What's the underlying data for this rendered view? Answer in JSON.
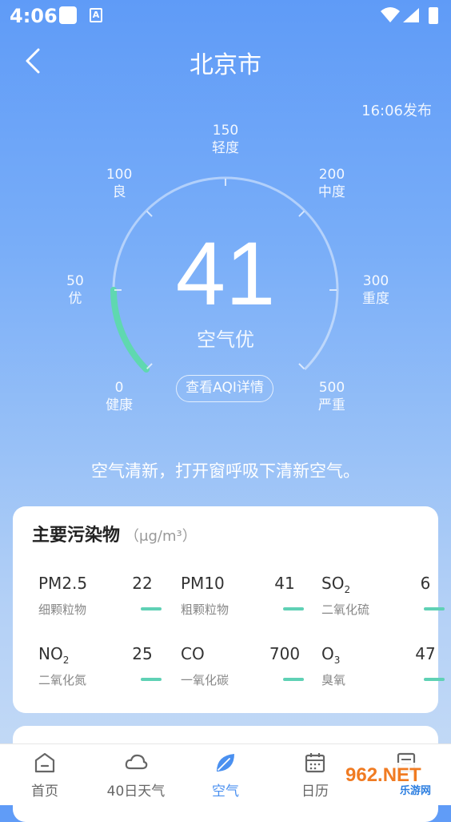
{
  "status": {
    "time": "4:06",
    "notif_icon_letter": "A"
  },
  "header": {
    "title": "北京市"
  },
  "publish_time": "16:06发布",
  "gauge": {
    "aqi": "41",
    "aqi_fraction": 0.082,
    "level": "空气优",
    "detail_button": "查看AQI详情",
    "accent_color": "#5fd8b0",
    "scale": [
      {
        "value": "0",
        "label": "健康"
      },
      {
        "value": "50",
        "label": "优"
      },
      {
        "value": "100",
        "label": "良"
      },
      {
        "value": "150",
        "label": "轻度"
      },
      {
        "value": "200",
        "label": "中度"
      },
      {
        "value": "300",
        "label": "重度"
      },
      {
        "value": "500",
        "label": "严重"
      }
    ]
  },
  "advice": "空气清新，打开窗呼吸下清新空气。",
  "pollutants": {
    "title": "主要污染物",
    "unit": "（μg/m³）",
    "items": [
      {
        "name": "PM2.5",
        "sub": "",
        "value": "22",
        "cn": "细颗粒物"
      },
      {
        "name": "PM10",
        "sub": "",
        "value": "41",
        "cn": "粗颗粒物"
      },
      {
        "name": "SO",
        "sub": "2",
        "value": "6",
        "cn": "二氧化硫"
      },
      {
        "name": "NO",
        "sub": "2",
        "value": "25",
        "cn": "二氧化氮"
      },
      {
        "name": "CO",
        "sub": "",
        "value": "700",
        "cn": "一氧化碳"
      },
      {
        "name": "O",
        "sub": "3",
        "value": "47",
        "cn": "臭氧"
      }
    ],
    "bar_color": "#5fd1b5"
  },
  "tabbar": {
    "tabs": [
      {
        "label": "首页",
        "icon": "home-icon"
      },
      {
        "label": "40日天气",
        "icon": "cloud-icon"
      },
      {
        "label": "空气",
        "icon": "leaf-icon"
      },
      {
        "label": "日历",
        "icon": "calendar-icon"
      },
      {
        "label": "",
        "icon": "document-icon"
      }
    ],
    "active_color": "#4a90f0"
  },
  "watermark": {
    "brand": "962.NET",
    "sub": "乐游网"
  }
}
